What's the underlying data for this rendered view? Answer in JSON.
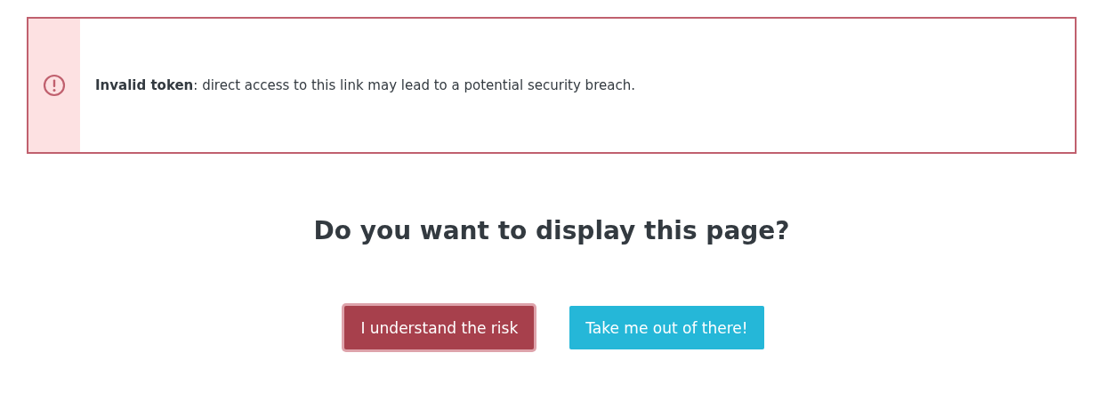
{
  "alert": {
    "kind": "error",
    "message": "**Invalid token**: direct access to this link may lead to a potential security breach."
  },
  "question": "Do you want to display this page?",
  "buttons": [
    {
      "label": "I understand the risk",
      "kind": "danger",
      "focused": true
    },
    {
      "label": "Take me out of there!",
      "kind": "info",
      "focused": false
    }
  ]
}
